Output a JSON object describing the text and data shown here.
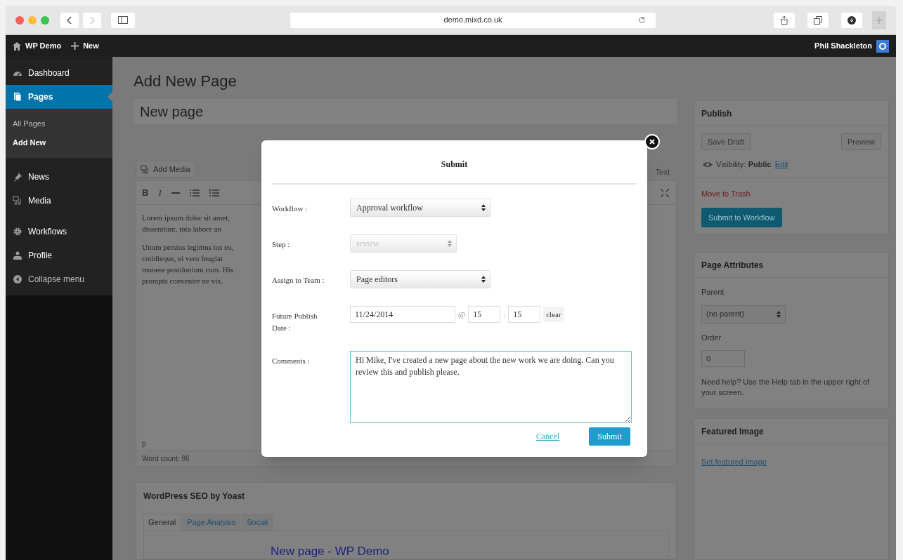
{
  "browser": {
    "url": "demo.mixd.co.uk"
  },
  "admin_bar": {
    "site": "WP Demo",
    "new": "New",
    "user": "Phil Shackleton"
  },
  "sidebar": {
    "items": [
      {
        "kind": "menu",
        "label": "Dashboard",
        "selected": false
      },
      {
        "kind": "menu",
        "label": "Pages",
        "selected": true,
        "children": [
          {
            "label": "All Pages",
            "selected": false
          },
          {
            "label": "Add New",
            "selected": true
          }
        ]
      },
      {
        "kind": "menu",
        "label": "News",
        "selected": false
      },
      {
        "kind": "menu",
        "label": "Media",
        "selected": false
      },
      {
        "kind": "menu",
        "label": "Workflows",
        "selected": false
      },
      {
        "kind": "menu",
        "label": "Profile",
        "selected": false
      },
      {
        "kind": "collapse",
        "label": "Collapse menu",
        "selected": false
      }
    ]
  },
  "page": {
    "heading": "Add New Page",
    "title_value": "New page",
    "add_media": "Add Media",
    "toolbar": [
      "B",
      "I"
    ],
    "text_tab": "Text",
    "paragraphs": [
      [
        "Lorem ipsum dolor sit amet,",
        "dissentiunt, tota labore an"
      ],
      [
        "Unum persius legimus ius eu,",
        "cotidieque, ei vero feugiat",
        "munere posidonium cum. His",
        "prompta convenire ne vix."
      ]
    ],
    "path": "p",
    "word_count": "Word count: 96"
  },
  "seo": {
    "title": "WordPress SEO by Yoast",
    "tabs": [
      {
        "label": "General",
        "selected": true
      },
      {
        "label": "Page Analysis",
        "selected": false
      },
      {
        "label": "Social",
        "selected": false
      }
    ],
    "snippet_title": "New page - WP Demo"
  },
  "publish": {
    "title": "Publish",
    "save_draft": "Save Draft",
    "preview": "Preview",
    "visibility_label": "Visibility:",
    "visibility_value": "Public",
    "edit": "Edit",
    "trash": "Move to Trash",
    "submit": "Submit to Workflow"
  },
  "page_attributes": {
    "title": "Page Attributes",
    "parent_label": "Parent",
    "parent_value": "(no parent)",
    "order_label": "Order",
    "order_value": "0",
    "help": "Need help? Use the Help tab in the upper right of your screen."
  },
  "featured_image": {
    "title": "Featured Image",
    "link": "Set featured image"
  },
  "dialog": {
    "title": "Submit",
    "fields": [
      {
        "kind": "select",
        "label": "Workflow :",
        "value": "Approval workflow",
        "disabled": false
      },
      {
        "kind": "select",
        "label": "Step :",
        "value": "review",
        "disabled": true
      },
      {
        "kind": "select",
        "label": "Assign to Team :",
        "value": "Page editors",
        "disabled": false
      },
      {
        "kind": "datetime",
        "label": "Future Publish Date :",
        "date": "11/24/2014",
        "at": "@",
        "hour": "15",
        "separator": ":",
        "minute": "15",
        "clear": "clear"
      },
      {
        "kind": "textarea",
        "label": "Comments :",
        "value": "Hi Mike, I've created a new page about the new work we are doing. Can you review this and publish please."
      }
    ],
    "cancel": "Cancel",
    "submit": "Submit"
  }
}
